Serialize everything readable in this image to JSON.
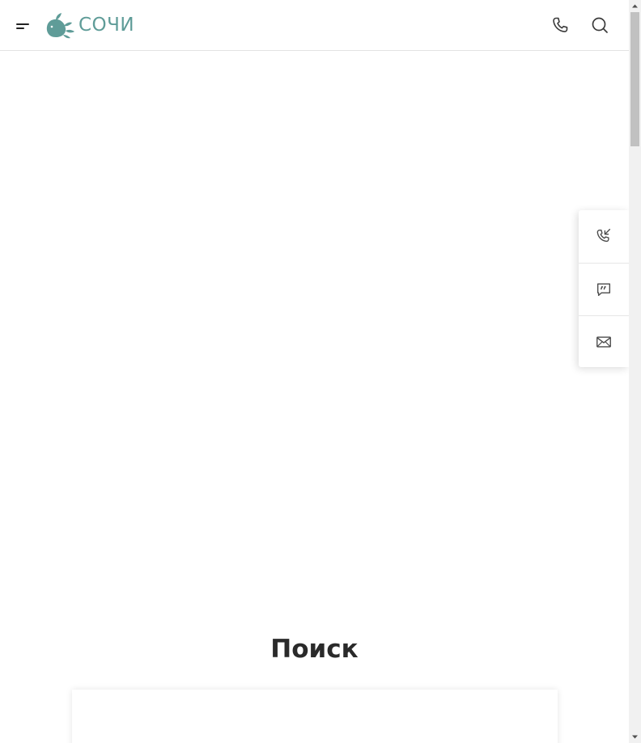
{
  "header": {
    "logo_text": "СОЧИ",
    "menu_icon": "menu-icon",
    "phone_icon": "phone-icon",
    "search_icon": "search-icon"
  },
  "side_panel": {
    "items": [
      {
        "icon": "phone-incoming-icon"
      },
      {
        "icon": "chat-quote-icon"
      },
      {
        "icon": "mail-icon"
      }
    ]
  },
  "main": {
    "search_title": "Поиск"
  },
  "colors": {
    "brand": "#5f9c98",
    "text_dark": "#2a2a2a",
    "divider": "#e3e3e3"
  }
}
